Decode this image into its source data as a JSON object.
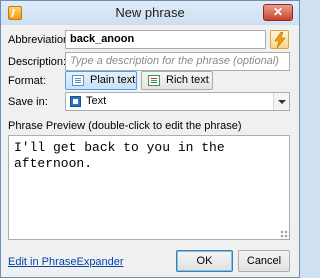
{
  "window": {
    "title": "New phrase",
    "close_label": "✕"
  },
  "form": {
    "abbreviation": {
      "label": "Abbreviation:",
      "value": "back_anoon"
    },
    "description": {
      "label": "Description:",
      "value": "",
      "placeholder": "Type a description for the phrase (optional)"
    },
    "format": {
      "label": "Format:",
      "options": [
        {
          "label": "Plain text",
          "selected": true
        },
        {
          "label": "Rich text",
          "selected": false
        }
      ]
    },
    "save_in": {
      "label": "Save in:",
      "value": "Text"
    }
  },
  "preview": {
    "label": "Phrase Preview (double-click to edit the phrase)",
    "text": "I'll get back to you in the afternoon."
  },
  "footer": {
    "link": "Edit in PhraseExpander",
    "ok_label": "OK",
    "cancel_label": "Cancel"
  },
  "colors": {
    "link": "#0645ad",
    "selected_format_bg": "#c9e1f7",
    "close_button": "#c7432d",
    "lightning": "#f39c12"
  },
  "icons": [
    "app-icon",
    "lightning-icon",
    "plain-text-icon",
    "rich-text-icon",
    "folder-icon",
    "chevron-down-icon",
    "resize-grip-icon"
  ]
}
